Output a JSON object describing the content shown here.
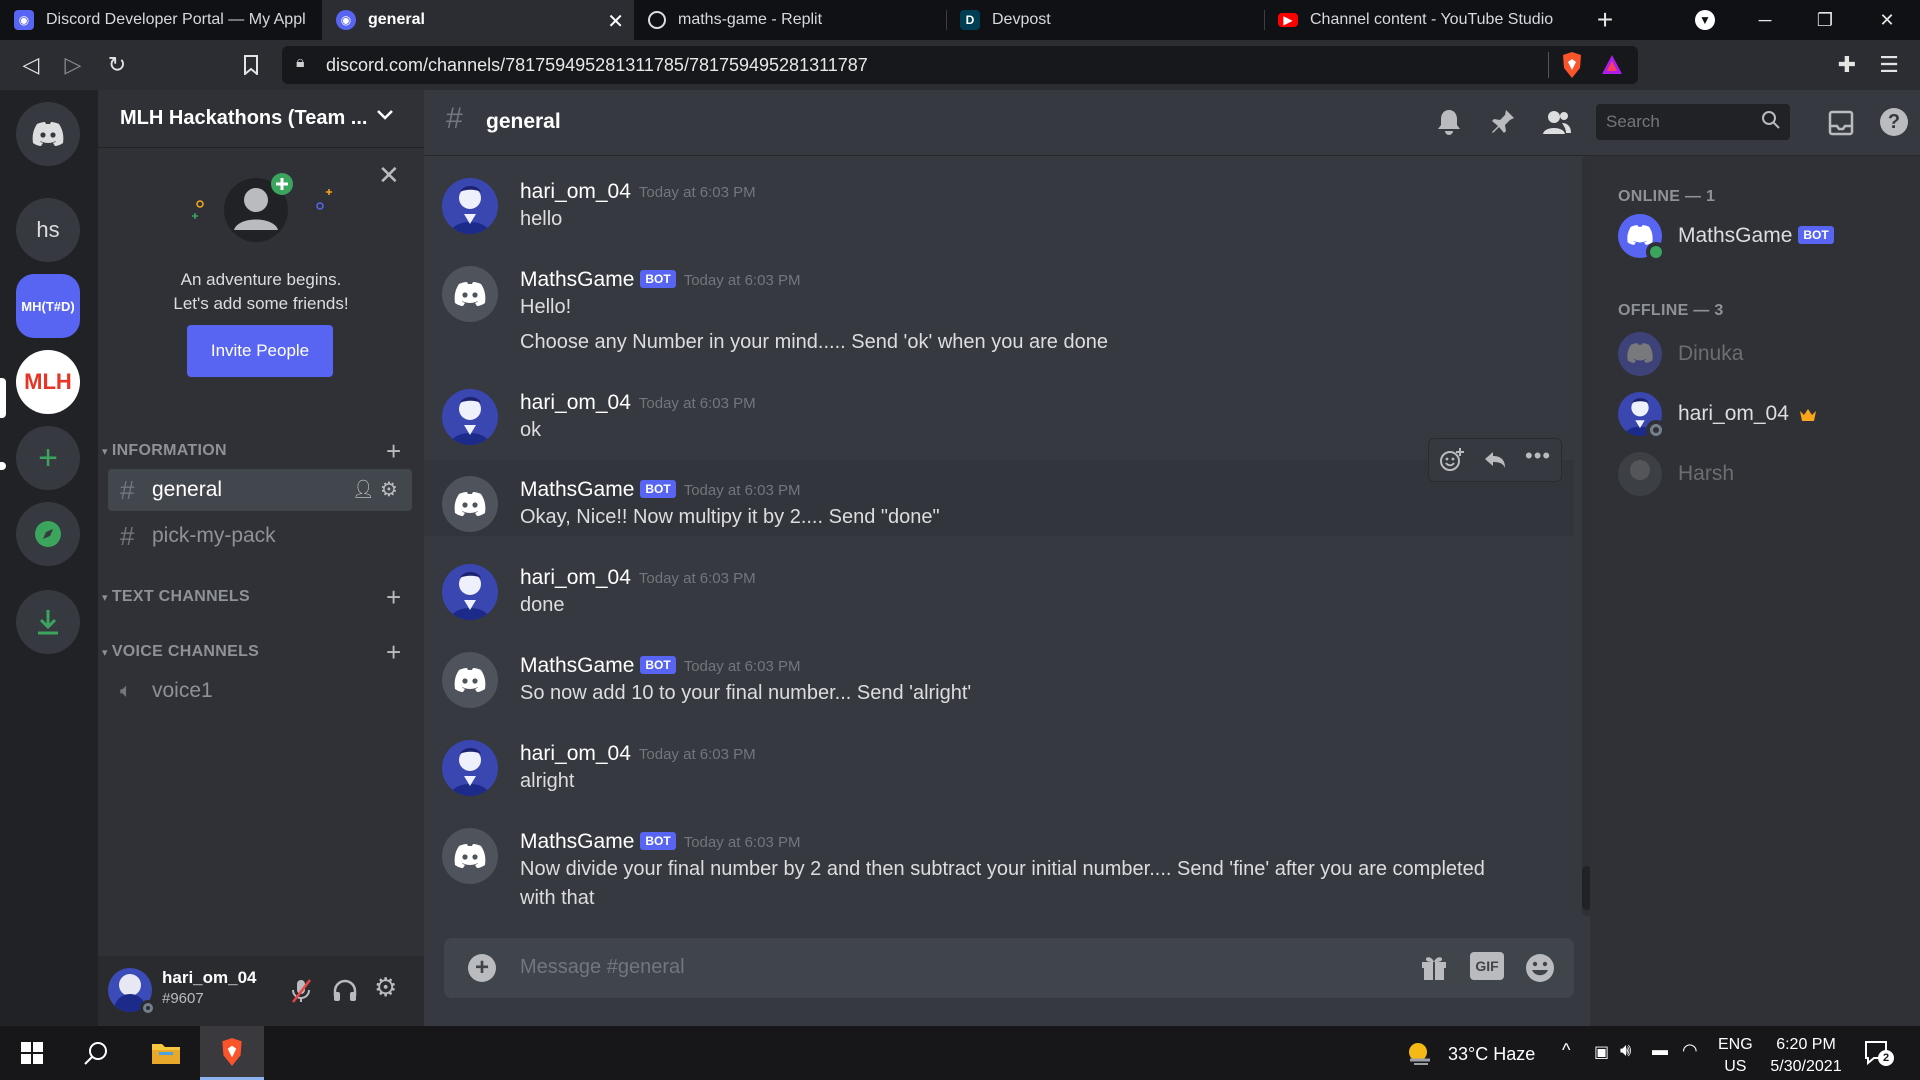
{
  "browser": {
    "tabs": [
      {
        "title": "Discord Developer Portal — My Appl",
        "favicon": "discord-icon"
      },
      {
        "title": "general",
        "favicon": "discord-icon"
      },
      {
        "title": "maths-game - Replit",
        "favicon": "replit-icon"
      },
      {
        "title": "Devpost",
        "favicon": "devpost-icon",
        "fav_letter": "D"
      },
      {
        "title": "Channel content - YouTube Studio",
        "favicon": "youtube-icon"
      }
    ],
    "url": "discord.com/channels/781759495281311785/781759495281311787"
  },
  "guilds": {
    "items": [
      {
        "label": "hs"
      },
      {
        "label": "MH(T#D)"
      },
      {
        "label": "MLH"
      }
    ]
  },
  "server": {
    "name": "MLH Hackathons (Team ...",
    "invite_text_1": "An adventure begins.",
    "invite_text_2": "Let's add some friends!",
    "invite_button": "Invite People",
    "categories": [
      {
        "name": "INFORMATION",
        "channels": [
          {
            "name": "general",
            "type": "text",
            "selected": true
          },
          {
            "name": "pick-my-pack",
            "type": "text"
          }
        ]
      },
      {
        "name": "TEXT CHANNELS",
        "channels": []
      },
      {
        "name": "VOICE CHANNELS",
        "channels": [
          {
            "name": "voice1",
            "type": "voice"
          }
        ]
      }
    ]
  },
  "user": {
    "name": "hari_om_04",
    "tag": "#9607"
  },
  "channel": {
    "name": "general",
    "search_placeholder": "Search"
  },
  "messages": [
    {
      "author": "hari_om_04",
      "bot": false,
      "time": "Today at 6:03 PM",
      "lines": [
        "hello"
      ]
    },
    {
      "author": "MathsGame",
      "bot": true,
      "time": "Today at 6:03 PM",
      "lines": [
        "Hello!",
        "Choose any Number in your mind..... Send 'ok' when you are done"
      ]
    },
    {
      "author": "hari_om_04",
      "bot": false,
      "time": "Today at 6:03 PM",
      "lines": [
        "ok"
      ]
    },
    {
      "author": "MathsGame",
      "bot": true,
      "time": "Today at 6:03 PM",
      "lines": [
        "Okay, Nice!! Now multipy it by 2....  Send \"done\""
      ]
    },
    {
      "author": "hari_om_04",
      "bot": false,
      "time": "Today at 6:03 PM",
      "lines": [
        "done"
      ]
    },
    {
      "author": "MathsGame",
      "bot": true,
      "time": "Today at 6:03 PM",
      "lines": [
        "So now add 10 to your final number... Send 'alright'"
      ]
    },
    {
      "author": "hari_om_04",
      "bot": false,
      "time": "Today at 6:03 PM",
      "lines": [
        "alright"
      ]
    },
    {
      "author": "MathsGame",
      "bot": true,
      "time": "Today at 6:03 PM",
      "lines": [
        "Now divide your final number by 2 and then subtract your initial number.... Send 'fine' after you are completed",
        "with that"
      ]
    }
  ],
  "bot_badge": "BOT",
  "composer": {
    "placeholder": "Message #general",
    "gif_label": "GIF"
  },
  "members": {
    "online_header": "ONLINE — 1",
    "offline_header": "OFFLINE — 3",
    "online": [
      {
        "name": "MathsGame",
        "bot": true
      }
    ],
    "offline": [
      {
        "name": "Dinuka"
      },
      {
        "name": "hari_om_04",
        "owner": true
      },
      {
        "name": "Harsh"
      }
    ]
  },
  "taskbar": {
    "weather": "33°C  Haze",
    "lang_1": "ENG",
    "lang_2": "US",
    "time": "6:20 PM",
    "date": "5/30/2021",
    "notifications": "2"
  },
  "colors": {
    "blurple": "#5865f2",
    "online": "#3ba55d",
    "bg_chat": "#36393f",
    "bg_sidebar": "#2f3136"
  }
}
